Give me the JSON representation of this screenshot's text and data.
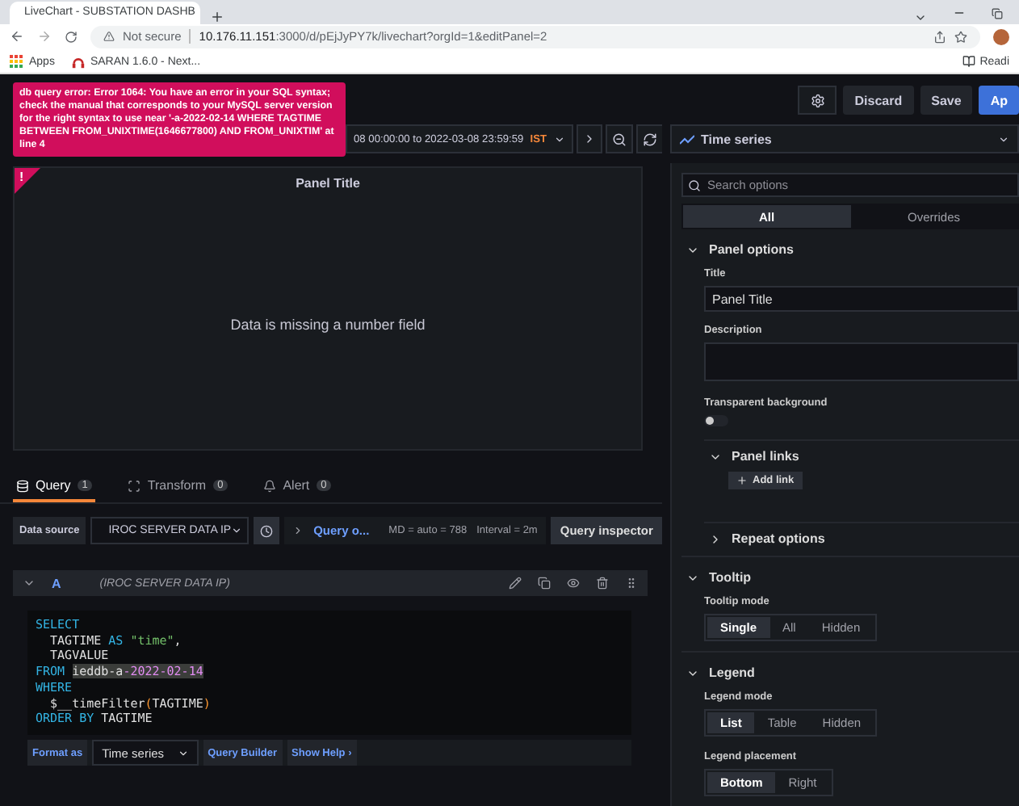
{
  "browser": {
    "tab_title": "LiveChart - SUBSTATION DASHB",
    "security": "Not secure",
    "url_host": "10.176.11.151",
    "url_path": ":3000/d/pEjJyPY7k/livechart?orgId=1&editPanel=2",
    "bookmarks": [
      {
        "label": "Apps",
        "kind": "apps"
      },
      {
        "label": "SARAN 1.6.0 - Next...",
        "kind": "site"
      }
    ],
    "reading_list": "Readi"
  },
  "toolbar": {
    "buttons": [
      {
        "label": "Discard",
        "kind": "secondary"
      },
      {
        "label": "Save",
        "kind": "secondary"
      },
      {
        "label": "Ap",
        "kind": "primary"
      }
    ]
  },
  "time_range": {
    "range": "08 00:00:00 to 2022-03-08 23:59:59",
    "timezone": "IST"
  },
  "error_tooltip": "db query error: Error 1064: You have an error in your SQL syntax; check the manual that corresponds to your MySQL server version for the right syntax to use near '-a-2022-02-14 WHERE TAGTIME BETWEEN FROM_UNIXTIME(1646677800) AND FROM_UNIXTIM' at line 4",
  "panel": {
    "title": "Panel Title",
    "message": "Data is missing a number field",
    "error_mark": "!"
  },
  "query_tabs": [
    {
      "label": "Query",
      "count": "1",
      "kind": "query",
      "selected": true
    },
    {
      "label": "Transform",
      "count": "0",
      "kind": "transform",
      "selected": false
    },
    {
      "label": "Alert",
      "count": "0",
      "kind": "alert",
      "selected": false
    }
  ],
  "data_source": {
    "label": "Data source",
    "value": "IROC SERVER DATA IP",
    "query_options": "Query o...",
    "max_data_points": "MD = auto = 788",
    "interval": "Interval = 2m",
    "inspector": "Query inspector"
  },
  "query": {
    "ref": "A",
    "source": "(IROC SERVER DATA IP)",
    "expanded": true,
    "code": [
      [
        {
          "t": "SELECT",
          "kind": "kw"
        }
      ],
      [
        {
          "t": "  TAGTIME ",
          "kind": "text"
        },
        {
          "t": "AS ",
          "kind": "kw"
        },
        {
          "t": "\"time\"",
          "kind": "str"
        },
        {
          "t": ",",
          "kind": "text"
        }
      ],
      [
        {
          "t": "  TAGVALUE",
          "kind": "text"
        }
      ],
      [
        {
          "t": "FROM ",
          "kind": "kw"
        },
        {
          "t": "ieddb-a",
          "kind": "hl"
        },
        {
          "t": "-2022-02-14",
          "kind": "hlnum"
        }
      ],
      [
        {
          "t": "WHERE",
          "kind": "kw"
        }
      ],
      [
        {
          "t": "  $__timeFilter",
          "kind": "text"
        },
        {
          "t": "(",
          "kind": "paren"
        },
        {
          "t": "TAGTIME",
          "kind": "text"
        },
        {
          "t": ")",
          "kind": "paren"
        }
      ],
      [
        {
          "t": "ORDER BY",
          "kind": "kw"
        },
        {
          "t": " TAGTIME",
          "kind": "text"
        }
      ]
    ],
    "format_label": "Format as",
    "format_value": "Time series",
    "builder": "Query Builder",
    "help": "Show Help ›"
  },
  "options": {
    "visualization": "Time series",
    "search_placeholder": "Search options",
    "tabs": [
      {
        "label": "All",
        "selected": true
      },
      {
        "label": "Overrides",
        "selected": false
      }
    ],
    "sections": [
      {
        "title": "Panel options",
        "expanded": true,
        "items": [
          {
            "kind": "input",
            "label": "Title",
            "value": "Panel Title"
          },
          {
            "kind": "textarea",
            "label": "Description"
          },
          {
            "kind": "switch",
            "label": "Transparent background",
            "on": false
          },
          {
            "kind": "subsection",
            "title": "Panel links",
            "expanded": true,
            "button": "Add link"
          },
          {
            "kind": "subsection",
            "title": "Repeat options",
            "expanded": false
          }
        ]
      },
      {
        "title": "Tooltip",
        "expanded": true,
        "items": [
          {
            "kind": "radio",
            "label": "Tooltip mode",
            "options": [
              {
                "label": "Single",
                "selected": true
              },
              {
                "label": "All",
                "selected": false
              },
              {
                "label": "Hidden",
                "selected": false
              }
            ]
          }
        ]
      },
      {
        "title": "Legend",
        "expanded": true,
        "items": [
          {
            "kind": "radio",
            "label": "Legend mode",
            "options": [
              {
                "label": "List",
                "selected": true
              },
              {
                "label": "Table",
                "selected": false
              },
              {
                "label": "Hidden",
                "selected": false
              }
            ]
          },
          {
            "kind": "radio",
            "label": "Legend placement",
            "options": [
              {
                "label": "Bottom",
                "selected": true
              },
              {
                "label": "Right",
                "selected": false
              }
            ]
          }
        ]
      }
    ]
  }
}
